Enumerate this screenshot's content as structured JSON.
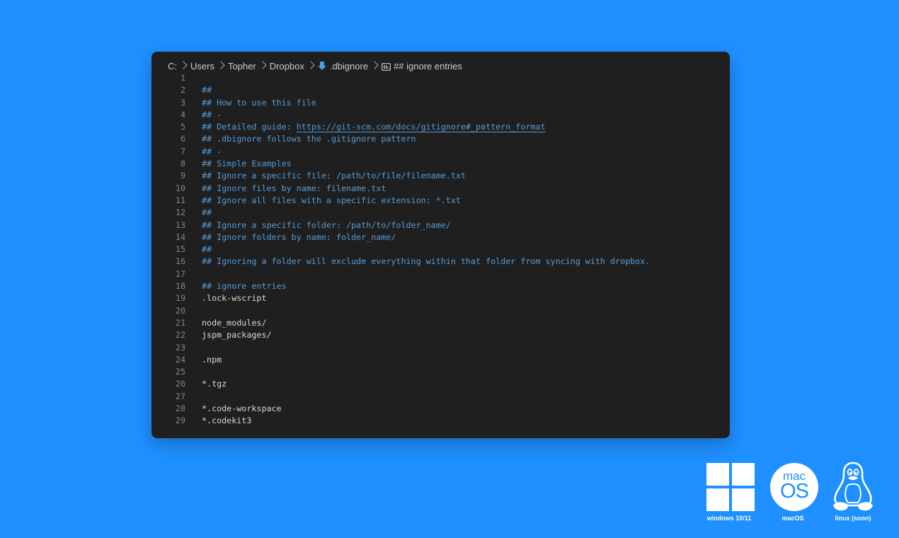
{
  "breadcrumb": {
    "items": [
      "C:",
      "Users",
      "Topher",
      "Dropbox",
      ".dbignore",
      "## ignore entries"
    ]
  },
  "code_lines": [
    {
      "n": "1",
      "text": "",
      "kind": "plain"
    },
    {
      "n": "2",
      "text": "##",
      "kind": "comment"
    },
    {
      "n": "3",
      "text": "## How to use this file",
      "kind": "comment"
    },
    {
      "n": "4",
      "text": "## -",
      "kind": "comment"
    },
    {
      "n": "5",
      "text": "## Detailed guide: ",
      "link": "https://git-scm.com/docs/gitignore#_pattern_format",
      "kind": "comment"
    },
    {
      "n": "6",
      "text": "## .dbignore follows the .gitignore pattern",
      "kind": "comment"
    },
    {
      "n": "7",
      "text": "## -",
      "kind": "comment"
    },
    {
      "n": "8",
      "text": "## Simple Examples",
      "kind": "comment"
    },
    {
      "n": "9",
      "text": "## Ignore a specific file: /path/to/file/filename.txt",
      "kind": "comment"
    },
    {
      "n": "10",
      "text": "## Ignore files by name: filename.txt",
      "kind": "comment"
    },
    {
      "n": "11",
      "text": "## Ignore all files with a specific extension: *.txt",
      "kind": "comment"
    },
    {
      "n": "12",
      "text": "##",
      "kind": "comment"
    },
    {
      "n": "13",
      "text": "## Ignore a specific folder: /path/to/folder_name/",
      "kind": "comment"
    },
    {
      "n": "14",
      "text": "## Ignore folders by name: folder_name/",
      "kind": "comment"
    },
    {
      "n": "15",
      "text": "##",
      "kind": "comment"
    },
    {
      "n": "16",
      "text": "## Ignoring a folder will exclude everything within that folder from syncing with dropbox.",
      "kind": "comment"
    },
    {
      "n": "17",
      "text": "",
      "kind": "plain"
    },
    {
      "n": "18",
      "text": "## ignore entries",
      "kind": "comment"
    },
    {
      "n": "19",
      "text": ".lock-wscript",
      "kind": "plain"
    },
    {
      "n": "20",
      "text": "",
      "kind": "plain"
    },
    {
      "n": "21",
      "text": "node_modules/",
      "kind": "plain"
    },
    {
      "n": "22",
      "text": "jspm_packages/",
      "kind": "plain"
    },
    {
      "n": "23",
      "text": "",
      "kind": "plain"
    },
    {
      "n": "24",
      "text": ".npm",
      "kind": "plain"
    },
    {
      "n": "25",
      "text": "",
      "kind": "plain"
    },
    {
      "n": "26",
      "text": "*.tgz",
      "kind": "plain"
    },
    {
      "n": "27",
      "text": "",
      "kind": "plain"
    },
    {
      "n": "28",
      "text": "*.code-workspace",
      "kind": "plain"
    },
    {
      "n": "29",
      "text": "*.codekit3",
      "kind": "plain"
    }
  ],
  "os_badges": {
    "windows": {
      "label": "windows 10/11",
      "icon": "windows-logo-icon"
    },
    "macos": {
      "label": "macOS",
      "icon": "macos-logo-icon",
      "logo_top": "mac",
      "logo_bottom": "OS"
    },
    "linux": {
      "label": "linux (soon)",
      "icon": "tux-penguin-icon"
    }
  },
  "colors": {
    "background": "#1e90ff",
    "editor_bg": "#1f1f1f",
    "comment": "#569cd6",
    "text": "#d4d4d4",
    "line_number": "#858585"
  }
}
